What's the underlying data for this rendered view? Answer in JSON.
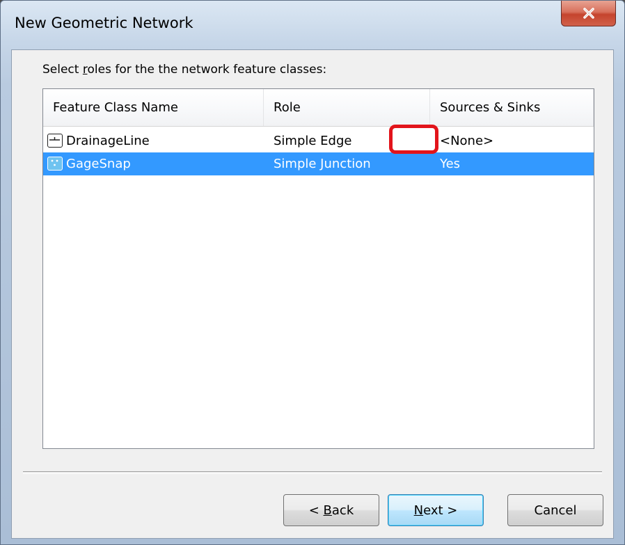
{
  "window": {
    "title": "New Geometric Network",
    "close_icon": "close-icon"
  },
  "instruction": {
    "prefix": "Select ",
    "mnemonic": "r",
    "suffix": "oles for the the network feature classes:"
  },
  "list": {
    "columns": [
      "Feature Class Name",
      "Role",
      "Sources & Sinks"
    ],
    "rows": [
      {
        "name": "DrainageLine",
        "role": "Simple Edge",
        "sources_sinks": "<None>",
        "icon": "line-feature-icon",
        "selected": false
      },
      {
        "name": "GageSnap",
        "role": "Simple Junction",
        "sources_sinks": "Yes",
        "icon": "point-feature-icon",
        "selected": true
      }
    ]
  },
  "buttons": {
    "back": {
      "prefix": "< ",
      "mnemonic": "B",
      "suffix": "ack"
    },
    "next": {
      "prefix": "",
      "mnemonic": "N",
      "suffix": "ext >"
    },
    "cancel": "Cancel"
  },
  "colors": {
    "selection": "#3399ff",
    "highlight_annotation": "#e2141b"
  }
}
